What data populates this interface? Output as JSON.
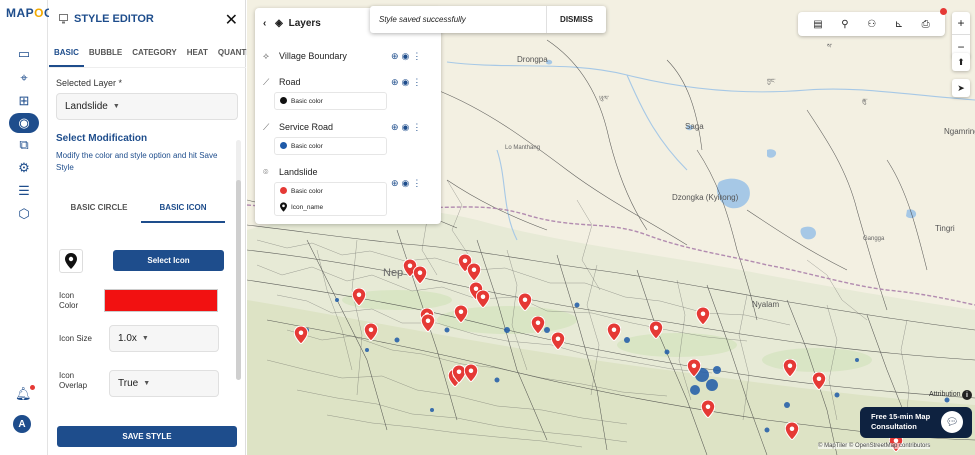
{
  "brand": {
    "logo_pre": "MAP",
    "logo_o": "O",
    "logo_post": "G"
  },
  "rail": {
    "icons": [
      "map-icon",
      "location-pin-icon",
      "add-file-icon",
      "style-palette-icon",
      "analysis-icon",
      "settings-gear-icon",
      "table-icon",
      "layers-share-icon"
    ],
    "active_index": 3,
    "avatar_letter": "A"
  },
  "editor": {
    "title": "STYLE EDITOR",
    "tabs": [
      "BASIC",
      "BUBBLE",
      "CATEGORY",
      "HEAT",
      "QUANTITY"
    ],
    "active_tab": "BASIC",
    "selected_layer_label": "Selected Layer *",
    "selected_layer_value": "Landslide",
    "section_title": "Select Modification",
    "section_desc": "Modify the color and style option and hit Save Style",
    "subtabs": [
      "BASIC CIRCLE",
      "BASIC ICON"
    ],
    "active_subtab": "BASIC ICON",
    "select_icon_button": "Select Icon",
    "icon_color_label": "Icon Color",
    "icon_color_value": "#f21111",
    "icon_size_label": "Icon Size",
    "icon_size_value": "1.0x",
    "icon_overlap_label": "Icon Overlap",
    "icon_overlap_value": "True",
    "save_button": "SAVE STYLE"
  },
  "layers": {
    "title": "Layers",
    "items": [
      {
        "name": "Village Boundary",
        "legend": []
      },
      {
        "name": "Road",
        "legend": [
          {
            "label": "Basic color",
            "color": "#111111"
          }
        ]
      },
      {
        "name": "Service Road",
        "legend": [
          {
            "label": "Basic color",
            "color": "#1e5aa8"
          }
        ]
      },
      {
        "name": "Landslide",
        "legend": [
          {
            "label": "Basic color",
            "color": "#e53935"
          },
          {
            "label": "Icon_name",
            "color": "pin"
          }
        ]
      }
    ]
  },
  "toast": {
    "message": "Style saved successfully",
    "action": "DISMISS"
  },
  "map": {
    "places": [
      "Drongpa",
      "Saga",
      "Lo Manthang",
      "Dzongka (Kyirong)",
      "Ngamring",
      "Gangga",
      "Tingri",
      "Nyalam",
      "Nep"
    ],
    "tibetan_labels": [
      "ཡུལ་",
      "བྱང་",
      "ཆུ་",
      "ས་"
    ],
    "attribution_label": "Attribution",
    "attribution": "© MapTiler © OpenStreetMap contributors",
    "consult_line1": "Free 15-min Map",
    "consult_line2": "Consultation"
  },
  "colors": {
    "brand": "#1e4d8c",
    "pin": "#e53935",
    "accent": "#f2a900"
  }
}
